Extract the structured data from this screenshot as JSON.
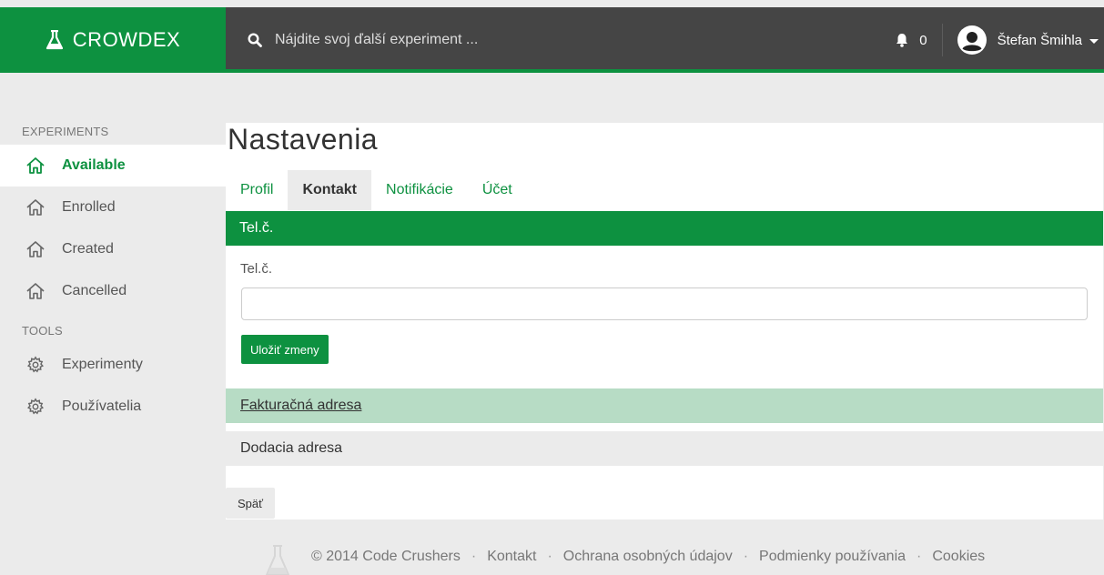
{
  "topbar": {
    "brand": "CROWDEX",
    "search_placeholder": "Nájdite svoj ďalší experiment ...",
    "notification_count": "0",
    "user_name": "Štefan Šmihla"
  },
  "sidebar": {
    "sections": [
      {
        "heading": "EXPERIMENTS",
        "items": [
          {
            "label": "Available",
            "icon": "home-icon",
            "active": true
          },
          {
            "label": "Enrolled",
            "icon": "home-icon"
          },
          {
            "label": "Created",
            "icon": "home-icon"
          },
          {
            "label": "Cancelled",
            "icon": "home-icon"
          }
        ]
      },
      {
        "heading": "TOOLS",
        "items": [
          {
            "label": "Experimenty",
            "icon": "gear-icon"
          },
          {
            "label": "Používatelia",
            "icon": "gear-icon"
          }
        ]
      }
    ]
  },
  "main": {
    "title": "Nastavenia",
    "tabs": [
      {
        "label": "Profil"
      },
      {
        "label": "Kontakt",
        "active": true
      },
      {
        "label": "Notifikácie"
      },
      {
        "label": "Účet"
      }
    ],
    "section_header": "Tel.č.",
    "field_label": "Tel.č.",
    "field_value": "",
    "save_label": "Uložiť zmeny",
    "accordion": [
      {
        "label": "Fakturačná adresa"
      },
      {
        "label": "Dodacia adresa"
      }
    ],
    "back_label": "Späť"
  },
  "footer": {
    "copyright": "© 2014 Code Crushers",
    "links": [
      "Kontakt",
      "Ochrana osobných údajov",
      "Podmienky používania",
      "Cookies"
    ]
  },
  "colors": {
    "brand_green": "#0d9140",
    "light_green": "#b7dcc5",
    "topbar_dark": "#454545"
  }
}
